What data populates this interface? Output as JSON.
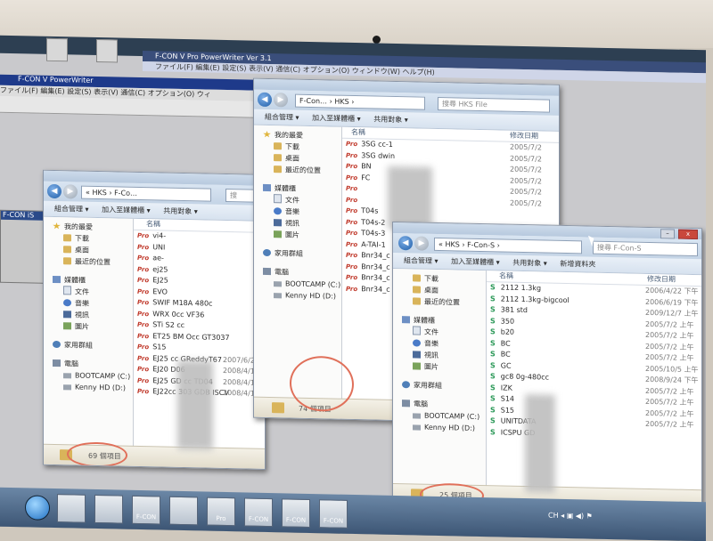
{
  "app": {
    "title": "F-CON V PowerWriter",
    "menu": "ファイル(F)  編集(E)  設定(S)  表示(V)  通信(C)  オプション(O)  ウィ",
    "mini_title": "F-CON V Pro PowerWriter Ver 3.1",
    "mini_menu": "ファイル(F)  編集(E)  設定(S)  表示(V)  通信(C)  オプション(O)  ウィンドウ(W)  ヘルプ(H)",
    "left_window_title": "F-CON iS"
  },
  "explorer_left": {
    "path": "« HKS › F-Co…",
    "search_placeholder": "搜",
    "toolbar": [
      "組合管理 ▾",
      "加入至媒體櫃 ▾",
      "共用對象 ▾"
    ],
    "nav": [
      {
        "label": "我的最愛",
        "icon": "star-icon",
        "kind": "head"
      },
      {
        "label": "下載",
        "icon": "folder-icon",
        "kind": "child"
      },
      {
        "label": "桌面",
        "icon": "folder-icon",
        "kind": "child"
      },
      {
        "label": "最近的位置",
        "icon": "folder-icon",
        "kind": "child"
      },
      {
        "label": "",
        "kind": "gap"
      },
      {
        "label": "媒體櫃",
        "icon": "library-icon",
        "kind": "head"
      },
      {
        "label": "文件",
        "icon": "document-icon",
        "kind": "child"
      },
      {
        "label": "音樂",
        "icon": "music-icon",
        "kind": "child"
      },
      {
        "label": "視訊",
        "icon": "video-icon",
        "kind": "child"
      },
      {
        "label": "圖片",
        "icon": "picture-icon",
        "kind": "child"
      },
      {
        "label": "",
        "kind": "gap"
      },
      {
        "label": "家用群組",
        "icon": "homegroup-icon",
        "kind": "head"
      },
      {
        "label": "",
        "kind": "gap"
      },
      {
        "label": "電腦",
        "icon": "computer-icon",
        "kind": "head"
      },
      {
        "label": "BOOTCAMP (C:)",
        "icon": "drive-icon",
        "kind": "child"
      },
      {
        "label": "Kenny HD (D:)",
        "icon": "drive-icon",
        "kind": "child"
      }
    ],
    "column_name": "名稱",
    "files": [
      {
        "name": "vi4-",
        "date": ""
      },
      {
        "name": "UNI",
        "date": ""
      },
      {
        "name": "ae-",
        "date": ""
      },
      {
        "name": "ej25",
        "date": ""
      },
      {
        "name": "EJ25",
        "date": ""
      },
      {
        "name": "EVO",
        "date": ""
      },
      {
        "name": "SWIF           M18A 480c",
        "date": ""
      },
      {
        "name": "WRX              0cc VF36",
        "date": ""
      },
      {
        "name": "STi S2             cc",
        "date": ""
      },
      {
        "name": "ET25 BM          Occ GT3037",
        "date": ""
      },
      {
        "name": "S15",
        "date": ""
      },
      {
        "name": "EJ25                cc GReddyT67",
        "date": "2007/6/25"
      },
      {
        "name": "EJ20              D06",
        "date": "2008/4/14"
      },
      {
        "name": "EJ25 GD          cc TD04",
        "date": "2008/4/14"
      },
      {
        "name": "EJ22cc 303        GDB ISCV",
        "date": "2008/4/18"
      }
    ],
    "status": "69 個項目"
  },
  "explorer_mid": {
    "path": "F-Con… › HKS ›",
    "search_placeholder": "搜尋 HKS File",
    "toolbar": [
      "組合管理 ▾",
      "加入至媒體櫃 ▾",
      "共用對象 ▾"
    ],
    "nav": [
      {
        "label": "我的最愛",
        "icon": "star-icon",
        "kind": "head"
      },
      {
        "label": "下載",
        "icon": "folder-icon",
        "kind": "child"
      },
      {
        "label": "桌面",
        "icon": "folder-icon",
        "kind": "child"
      },
      {
        "label": "最近的位置",
        "icon": "folder-icon",
        "kind": "child"
      },
      {
        "label": "",
        "kind": "gap"
      },
      {
        "label": "媒體櫃",
        "icon": "library-icon",
        "kind": "head"
      },
      {
        "label": "文件",
        "icon": "document-icon",
        "kind": "child"
      },
      {
        "label": "音樂",
        "icon": "music-icon",
        "kind": "child"
      },
      {
        "label": "視訊",
        "icon": "video-icon",
        "kind": "child"
      },
      {
        "label": "圖片",
        "icon": "picture-icon",
        "kind": "child"
      },
      {
        "label": "",
        "kind": "gap"
      },
      {
        "label": "家用群組",
        "icon": "homegroup-icon",
        "kind": "head"
      },
      {
        "label": "",
        "kind": "gap"
      },
      {
        "label": "電腦",
        "icon": "computer-icon",
        "kind": "head"
      },
      {
        "label": "BOOTCAMP (C:)",
        "icon": "drive-icon",
        "kind": "child"
      },
      {
        "label": "Kenny HD (D:)",
        "icon": "drive-icon",
        "kind": "child"
      }
    ],
    "column_name": "名稱",
    "column_date": "修改日期",
    "files": [
      {
        "name": "3SG            cc-1",
        "date": "2005/7/2"
      },
      {
        "name": "3SG            dwin",
        "date": "2005/7/2"
      },
      {
        "name": "BN",
        "date": "2005/7/2"
      },
      {
        "name": "FC",
        "date": "2005/7/2"
      },
      {
        "name": "",
        "date": "2005/7/2"
      },
      {
        "name": "",
        "date": "2005/7/2"
      },
      {
        "name": "T04s",
        "date": ""
      },
      {
        "name": "T04s-2",
        "date": ""
      },
      {
        "name": "T04s-3",
        "date": ""
      },
      {
        "name": "A-TAI-1",
        "date": ""
      },
      {
        "name": "Bnr34_c",
        "date": ""
      },
      {
        "name": "Bnr34_c",
        "date": ""
      },
      {
        "name": "Bnr34_c",
        "date": ""
      },
      {
        "name": "Bnr34_c",
        "date": ""
      }
    ],
    "status": "74 個項目"
  },
  "explorer_right": {
    "path": "« HKS › F-Con-S ›",
    "search_placeholder": "搜尋 F-Con-S",
    "toolbar": [
      "組合管理 ▾",
      "加入至媒體櫃 ▾",
      "共用對象 ▾",
      "新增資料夾"
    ],
    "nav": [
      {
        "label": "下載",
        "icon": "folder-icon",
        "kind": "child"
      },
      {
        "label": "桌面",
        "icon": "folder-icon",
        "kind": "child"
      },
      {
        "label": "最近的位置",
        "icon": "folder-icon",
        "kind": "child"
      },
      {
        "label": "",
        "kind": "gap"
      },
      {
        "label": "媒體櫃",
        "icon": "library-icon",
        "kind": "head"
      },
      {
        "label": "文件",
        "icon": "document-icon",
        "kind": "child"
      },
      {
        "label": "音樂",
        "icon": "music-icon",
        "kind": "child"
      },
      {
        "label": "視訊",
        "icon": "video-icon",
        "kind": "child"
      },
      {
        "label": "圖片",
        "icon": "picture-icon",
        "kind": "child"
      },
      {
        "label": "",
        "kind": "gap"
      },
      {
        "label": "家用群組",
        "icon": "homegroup-icon",
        "kind": "head"
      },
      {
        "label": "",
        "kind": "gap"
      },
      {
        "label": "電腦",
        "icon": "computer-icon",
        "kind": "head"
      },
      {
        "label": "BOOTCAMP (C:)",
        "icon": "drive-icon",
        "kind": "child"
      },
      {
        "label": "Kenny HD (D:)",
        "icon": "drive-icon",
        "kind": "child"
      }
    ],
    "column_name": "名稱",
    "column_date": "修改日期",
    "files": [
      {
        "name": "2112           1.3kg",
        "date": "2006/4/22 下午"
      },
      {
        "name": "2112           1.3kg-bigcool",
        "date": "2006/6/19 下午"
      },
      {
        "name": "381             std",
        "date": "2009/12/7 上午"
      },
      {
        "name": "350",
        "date": "2005/7/2 上午"
      },
      {
        "name": "b20",
        "date": "2005/7/2 上午"
      },
      {
        "name": "BC",
        "date": "2005/7/2 上午"
      },
      {
        "name": "BC",
        "date": "2005/7/2 上午"
      },
      {
        "name": "GC",
        "date": "2005/10/5 上午"
      },
      {
        "name": "gc8            0g-480cc",
        "date": "2008/9/24 下午"
      },
      {
        "name": "IZK",
        "date": "2005/7/2 上午"
      },
      {
        "name": "S14",
        "date": "2005/7/2 上午"
      },
      {
        "name": "S15",
        "date": "2005/7/2 上午"
      },
      {
        "name": "UNITDATA",
        "date": "2005/7/2 上午"
      },
      {
        "name": "ICSPU GD",
        "date": ""
      }
    ],
    "status": "25 個項目"
  },
  "taskbar": {
    "items": [
      "F-CON Pro",
      "",
      "",
      "",
      "Pro",
      "F-CON",
      "F-CON",
      "F-CON"
    ],
    "tray_text": "CH  ◂  ▣  ◀)  ⚑"
  },
  "colors": {
    "highlight_circle": "#e0705a",
    "pro_badge": "#c0392b",
    "s_icon": "#2e9a5a"
  }
}
